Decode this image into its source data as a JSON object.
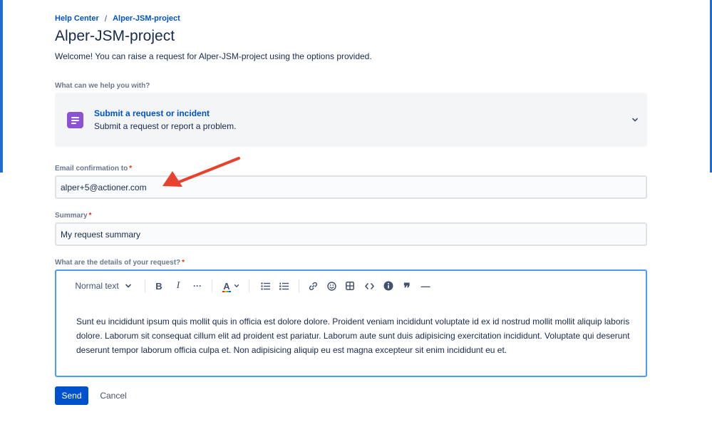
{
  "breadcrumb": {
    "home": "Help Center",
    "separator": "/",
    "project": "Alper-JSM-project"
  },
  "page": {
    "title": "Alper-JSM-project",
    "welcome": "Welcome! You can raise a request for Alper-JSM-project using the options provided."
  },
  "request_type": {
    "label": "What can we help you with?",
    "title": "Submit a request or incident",
    "description": "Submit a request or report a problem.",
    "icon": "document-icon",
    "icon_color": "#8b52d6"
  },
  "email": {
    "label": "Email confirmation to",
    "required": "*",
    "value": "alper+5@actioner.com"
  },
  "summary": {
    "label": "Summary",
    "required": "*",
    "value": "My request summary"
  },
  "details": {
    "label": "What are the details of your request?",
    "required": "*",
    "text_style": "Normal text",
    "body": "Sunt eu incididunt ipsum quis mollit quis in officia est dolore dolore. Proident veniam incididunt voluptate id ex id nostrud mollit mollit aliquip laboris dolore. Laborum sit consequat cillum elit ad proident est pariatur. Laborum aute sunt duis adipisicing exercitation incididunt. Voluptate qui deserunt deserunt tempor laborum officia culpa et. Non adipisicing aliquip eu est magna excepteur sit enim incididunt eu et."
  },
  "toolbar": {
    "bold": "B",
    "italic": "I",
    "more": "···",
    "text_color": "A",
    "quote": "❞",
    "divider": "—"
  },
  "actions": {
    "send": "Send",
    "cancel": "Cancel"
  },
  "colors": {
    "primary": "#0052cc",
    "required": "#de350b",
    "annotation_arrow": "#e8412d",
    "focus": "#4c9aff"
  }
}
